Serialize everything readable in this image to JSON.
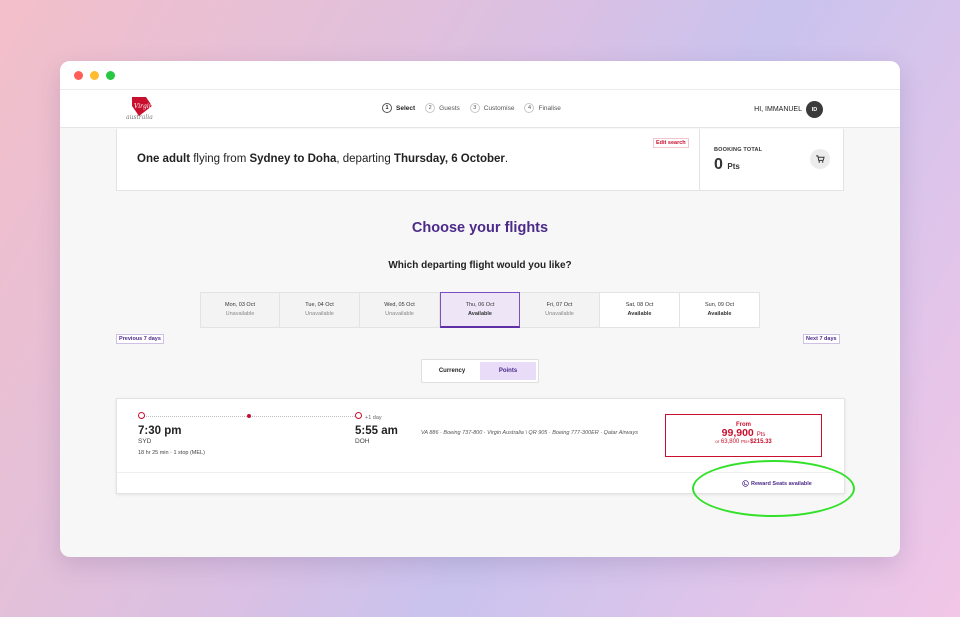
{
  "brand": {
    "logo_text": "Virgin",
    "sub_text": "australia",
    "accent": "#c8102e",
    "primary": "#4b2a8a"
  },
  "steps": [
    {
      "num": "1",
      "label": "Select",
      "active": true
    },
    {
      "num": "2",
      "label": "Guests",
      "active": false
    },
    {
      "num": "3",
      "label": "Customise",
      "active": false
    },
    {
      "num": "4",
      "label": "Finalise",
      "active": false
    }
  ],
  "user": {
    "greeting": "HI, IMMANUEL",
    "initials": "ID"
  },
  "summary": {
    "part1": "One adult",
    "part2": " flying from ",
    "part3": "Sydney to Doha",
    "part4": ", departing ",
    "part5": "Thursday, 6 October",
    "part6": ".",
    "edit_label": "Edit search"
  },
  "booking": {
    "label": "BOOKING TOTAL",
    "value": "0",
    "unit": "Pts"
  },
  "page": {
    "heading": "Choose your flights",
    "subheading": "Which departing flight would you like?"
  },
  "dates": [
    {
      "day": "Mon, 03 Oct",
      "status": "Unavailable",
      "state": "unavailable"
    },
    {
      "day": "Tue, 04 Oct",
      "status": "Unavailable",
      "state": "unavailable"
    },
    {
      "day": "Wed, 05 Oct",
      "status": "Unavailable",
      "state": "unavailable"
    },
    {
      "day": "Thu, 06 Oct",
      "status": "Available",
      "state": "selected"
    },
    {
      "day": "Fri, 07 Oct",
      "status": "Unavailable",
      "state": "unavailable"
    },
    {
      "day": "Sat, 08 Oct",
      "status": "Available",
      "state": "available"
    },
    {
      "day": "Sun, 09 Oct",
      "status": "Available",
      "state": "available"
    }
  ],
  "nav": {
    "prev": "Previous 7 days",
    "next": "Next 7 days"
  },
  "toggle": {
    "currency": "Currency",
    "points": "Points",
    "selected": "Points"
  },
  "flight": {
    "dep_time": "7:30 pm",
    "dep_code": "SYD",
    "duration": "18 hr 25 min · 1 stop (MEL)",
    "plus_day": "+1 day",
    "arr_time": "5:55 am",
    "arr_code": "DOH",
    "carrier": "VA 886 · Boeing 737-800 · Virgin Australia \\ QR 905 · Boeing 777-300ER · Qatar Airways",
    "price_from": "From",
    "price_points": "99,900",
    "price_points_unit": "Pts",
    "alt_prefix": "or",
    "alt_points": "63,800",
    "alt_unit": "Pts+",
    "alt_cash": "$215.33",
    "reward_label": "Reward Seats available"
  },
  "icons": {
    "cart": "cart-icon",
    "reward": "reward-seat-icon",
    "logo": "virgin-logo-icon"
  },
  "annotation_color": "#33e02a"
}
